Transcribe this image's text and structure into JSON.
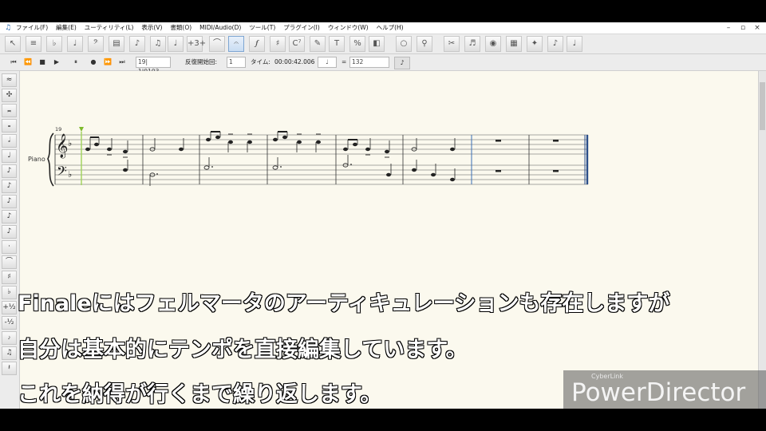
{
  "menubar": {
    "items": [
      "ファイル(F)",
      "編集(E)",
      "ユーティリティ(L)",
      "表示(V)",
      "書類(O)",
      "MIDI/Audio(D)",
      "ツール(T)",
      "プラグイン(I)",
      "ウィンドウ(W)",
      "ヘルプ(H)"
    ],
    "window_controls": [
      "–",
      "▫",
      "×"
    ]
  },
  "toolbar": {
    "tools": [
      "selection-tool",
      "staff-tool",
      "key-signature-tool",
      "time-signature-tool",
      "clef-tool",
      "measure-tool",
      "simple-entry-tool",
      "speedy-entry-tool",
      "tuplet-tool",
      "smart-shape-tool",
      "articulation-tool",
      "expression-tool",
      "chord-tool",
      "lyrics-tool",
      "text-tool",
      "repeat-tool",
      "graphics-tool",
      "resize-tool",
      "zoom-tool",
      "mirror-tool",
      "special-tools",
      "hyperscribe-tool",
      "mixer-tool",
      "ossia-tool"
    ],
    "text_glyphs": {
      "tuplet": "+3+",
      "chord": "C⁷",
      "text": "T",
      "repeat": "%"
    }
  },
  "playback": {
    "measure_field": "19| 1|0103",
    "repeat_label": "反復開始回:",
    "repeat_value": "1",
    "time_label": "タイム:",
    "time_value": "00:00:42.006",
    "tempo_equals": "=",
    "tempo_value": "132"
  },
  "score": {
    "instrument": "Piano",
    "measure_number": "19"
  },
  "captions": {
    "line1": "Finaleにはフェルマータのアーティキュレーションも存在しますが",
    "line2": "自分は基本的にテンポを直接編集しています。",
    "line3": "これを納得が行くまで繰り返します。"
  },
  "watermark": {
    "small": "CyberLink",
    "big": "PowerDirector"
  },
  "colors": {
    "score_background": "#fbf9ee",
    "active_tool": "#c9dcf2",
    "playback_marker": "#7dbb2c",
    "barline_selected": "#3a6fb5"
  }
}
